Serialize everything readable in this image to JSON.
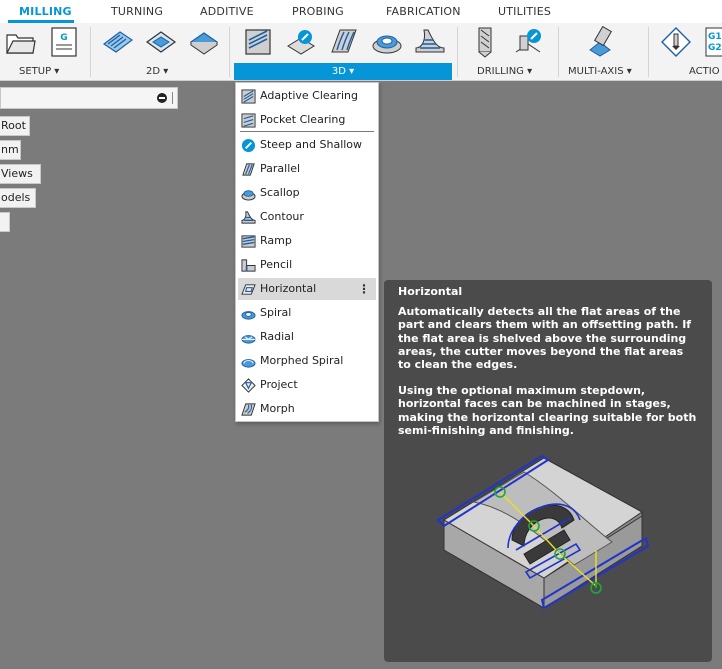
{
  "tabs": [
    {
      "label": "MILLING",
      "active": true
    },
    {
      "label": "TURNING"
    },
    {
      "label": "ADDITIVE"
    },
    {
      "label": "PROBING"
    },
    {
      "label": "FABRICATION"
    },
    {
      "label": "UTILITIES"
    }
  ],
  "ribbon": {
    "groups": {
      "setup": "SETUP ▾",
      "two_d": "2D ▾",
      "three_d": "3D ▾",
      "drilling": "DRILLING ▾",
      "multi_axis": "MULTI-AXIS ▾",
      "actions": "ACTIO"
    }
  },
  "browser": {
    "items": [
      "Root",
      "nm",
      "Views",
      "odels",
      ""
    ]
  },
  "menu": {
    "items": [
      {
        "label": "Adaptive Clearing",
        "icon": "adaptive-clearing-icon"
      },
      {
        "label": "Pocket Clearing",
        "icon": "pocket-clearing-icon"
      },
      {
        "label": "Steep and Shallow",
        "icon": "steep-and-shallow-icon"
      },
      {
        "label": "Parallel",
        "icon": "parallel-icon"
      },
      {
        "label": "Scallop",
        "icon": "scallop-icon"
      },
      {
        "label": "Contour",
        "icon": "contour-icon"
      },
      {
        "label": "Ramp",
        "icon": "ramp-icon"
      },
      {
        "label": "Pencil",
        "icon": "pencil-icon"
      },
      {
        "label": "Horizontal",
        "icon": "horizontal-icon"
      },
      {
        "label": "Spiral",
        "icon": "spiral-icon"
      },
      {
        "label": "Radial",
        "icon": "radial-icon"
      },
      {
        "label": "Morphed Spiral",
        "icon": "morphed-spiral-icon"
      },
      {
        "label": "Project",
        "icon": "project-icon"
      },
      {
        "label": "Morph",
        "icon": "morph-icon"
      }
    ],
    "more_glyph": "⋮"
  },
  "tooltip": {
    "title": "Horizontal",
    "para1": "Automatically detects all the flat areas of the part and clears them with an offsetting path. If the flat area is shelved above the surrounding areas, the cutter moves beyond the flat areas to clean the edges.",
    "para2": "Using the optional maximum stepdown, horizontal faces can be machined in stages, making the horizontal clearing suitable for both semi-finishing and finishing."
  },
  "colors": {
    "accent": "#0696d7",
    "viewport": "#7b7b7b",
    "tooltip_bg": "#4b4b4b",
    "toolpath": "#2233cc"
  }
}
